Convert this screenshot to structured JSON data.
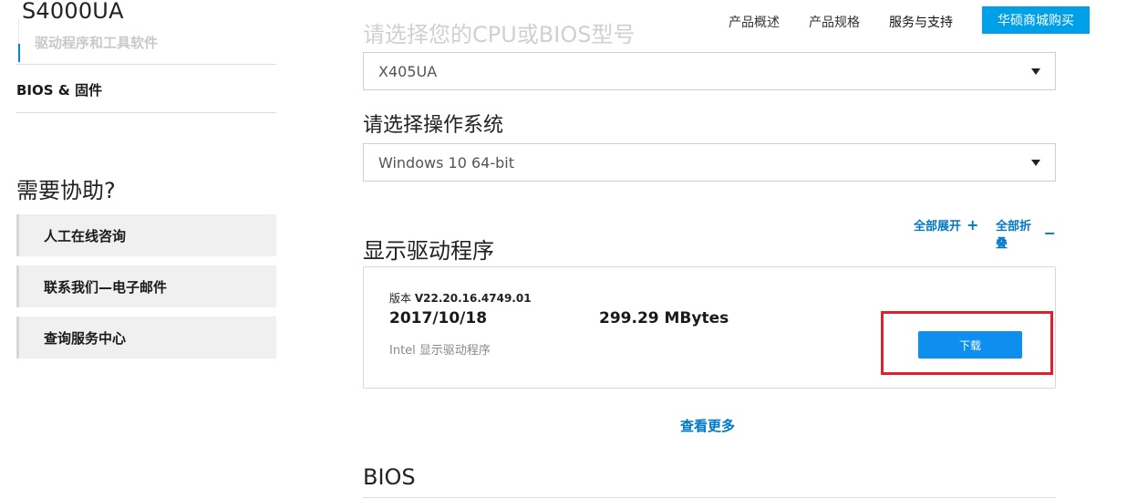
{
  "sidebar": {
    "model_title": "S4000UA",
    "drivers_link": "驱动程序和工具软件",
    "bios_link": "BIOS & 固件",
    "help_title": "需要协助?",
    "help_buttons": [
      {
        "label": "人工在线咨询"
      },
      {
        "label": "联系我们—电子邮件"
      },
      {
        "label": "查询服务中心"
      }
    ]
  },
  "topnav": {
    "items": [
      {
        "label": "产品概述"
      },
      {
        "label": "产品规格"
      },
      {
        "label": "服务与支持"
      }
    ],
    "buy_button": "华硕商城购买"
  },
  "main": {
    "cpu_bios_prompt": "请选择您的CPU或BIOS型号",
    "model_select_value": "X405UA",
    "os_prompt": "请选择操作系统",
    "os_select_value": "Windows 10 64-bit",
    "expand_all": "全部展开",
    "collapse_all": "全部折叠",
    "section_title": "显示驱动程序",
    "driver": {
      "version_label": "版本",
      "version": "V22.20.16.4749.01",
      "date": "2017/10/18",
      "size": "299.29 MBytes",
      "description": "Intel 显示驱动程序",
      "download_label": "下载"
    },
    "see_more": "查看更多",
    "bios_section_title": "BIOS"
  },
  "colors": {
    "accent": "#00a0e9",
    "link": "#0078c8",
    "download": "#0e8ff0",
    "highlight": "#e0202a"
  }
}
